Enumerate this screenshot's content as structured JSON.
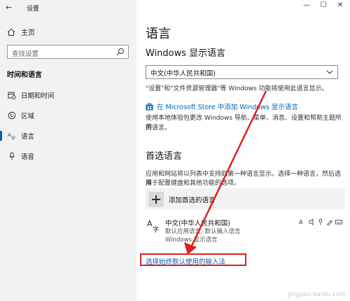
{
  "window": {
    "back_glyph": "←",
    "title": "设置",
    "minimize": "—",
    "maximize": "☐",
    "close": "✕"
  },
  "sidebar": {
    "home_label": "主页",
    "search_placeholder": "查找设置",
    "section_heading": "时间和语言",
    "items": [
      {
        "label": "日期和时间",
        "icon": "calendar-clock-icon"
      },
      {
        "label": "区域",
        "icon": "globe-icon"
      },
      {
        "label": "语言",
        "icon": "language-icon",
        "selected": true
      },
      {
        "label": "语音",
        "icon": "microphone-icon"
      }
    ]
  },
  "main": {
    "title": "语言",
    "display_language_heading": "Windows 显示语言",
    "display_language_value": "中文(中华人民共和国)",
    "display_language_note": "\"设置\"和\"文件资源管理器\"等 Windows 功能将使用此语言显示。",
    "store_link": "在 Microsoft Store 中添加 Windows 显示语言",
    "store_para_1": "使用本地体验包更改 Windows 导航、菜单、消息、设置和帮助主题所用",
    "store_para_2": "的语言。",
    "preferred_heading": "首选语言",
    "preferred_para_1": "应用和网站将以列表中支持的第一种语言显示。选择一种语言，然后选择",
    "preferred_para_2": "用于配置键盘和其他功能的选项。",
    "add_language_label": "添加首选的语言",
    "language_entry": {
      "name": "中文(中华人民共和国)",
      "sub1": "默认应用语言; 默认输入语言",
      "sub2": "Windows 显示语言"
    },
    "ime_link": "选择始终默认使用的输入法"
  },
  "watermark": "jingyan.baidu.com",
  "colors": {
    "accent": "#0063b1",
    "highlight_box": "#e02020",
    "arrow": "#e02020"
  }
}
